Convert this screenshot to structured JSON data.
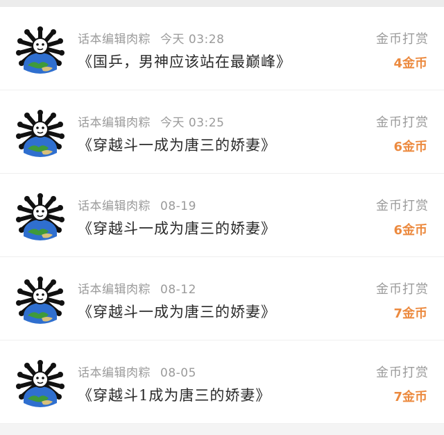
{
  "rewards": [
    {
      "user": "话本编辑肉粽",
      "time": "今天 03:28",
      "book": "《国乒，男神应该站在最巅峰》",
      "kind": "金币打赏",
      "amount": "4金币"
    },
    {
      "user": "话本编辑肉粽",
      "time": "今天 03:25",
      "book": "《穿越斗一成为唐三的娇妻》",
      "kind": "金币打赏",
      "amount": "6金币"
    },
    {
      "user": "话本编辑肉粽",
      "time": "08-19",
      "book": "《穿越斗一成为唐三的娇妻》",
      "kind": "金币打赏",
      "amount": "6金币"
    },
    {
      "user": "话本编辑肉粽",
      "time": "08-12",
      "book": "《穿越斗一成为唐三的娇妻》",
      "kind": "金币打赏",
      "amount": "7金币"
    },
    {
      "user": "话本编辑肉粽",
      "time": "08-05",
      "book": "《穿越斗1成为唐三的娇妻》",
      "kind": "金币打赏",
      "amount": "7金币"
    }
  ],
  "colors": {
    "accent": "#ec8a3f",
    "muted": "#9b9b9b",
    "text": "#2a2a2a"
  },
  "avatar_icon": "earth-bones-avatar-icon"
}
